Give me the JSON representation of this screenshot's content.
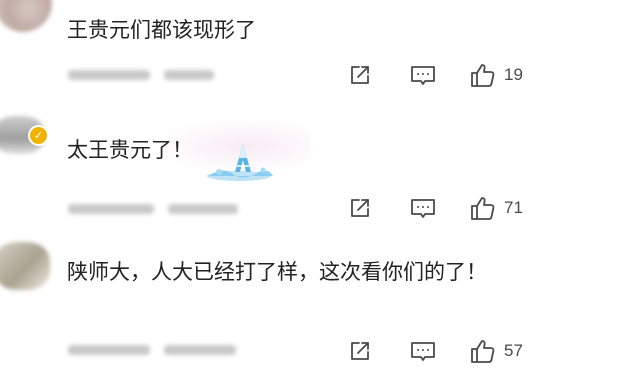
{
  "comments": [
    {
      "text": "王贵元们都该现形了",
      "likes": "19",
      "avatar_icon": "user-avatar",
      "verified": false
    },
    {
      "text": "太王贵元了！",
      "likes": "71",
      "avatar_icon": "user-avatar",
      "verified": true,
      "verified_color": "#f0b400",
      "sticker": "ice-crystal-sticker"
    },
    {
      "text": "陕师大，人大已经打了样，这次看你们的了！",
      "likes": "57",
      "avatar_icon": "user-avatar",
      "verified": false
    }
  ],
  "icons": {
    "share": "share-icon",
    "comment": "comment-icon",
    "like": "thumbs-up-icon"
  },
  "colors": {
    "text": "#222222",
    "icon": "#4a4a4a",
    "verified_badge": "#f0b400"
  }
}
